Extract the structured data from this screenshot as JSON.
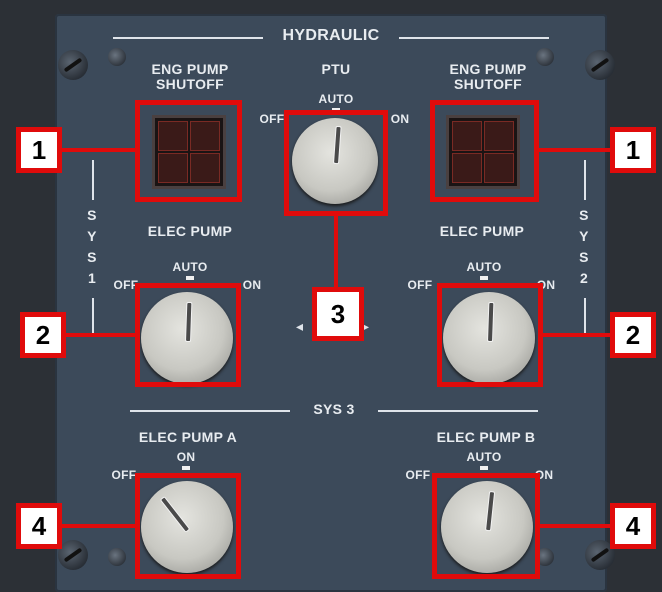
{
  "panel": {
    "title": "HYDRAULIC",
    "sys3_label": "SYS 3",
    "sys1_side_label": [
      "S",
      "Y",
      "S",
      "1"
    ],
    "sys2_side_label": [
      "S",
      "Y",
      "S",
      "2"
    ]
  },
  "eng_pump_left": {
    "label_line1": "ENG PUMP",
    "label_line2": "SHUTOFF"
  },
  "eng_pump_right": {
    "label_line1": "ENG PUMP",
    "label_line2": "SHUTOFF"
  },
  "ptu": {
    "label": "PTU",
    "pos_off": "OFF",
    "pos_auto": "AUTO",
    "pos_on": "ON"
  },
  "elec_pump_left": {
    "label": "ELEC PUMP",
    "pos_off": "OFF",
    "pos_auto": "AUTO",
    "pos_on": "ON"
  },
  "elec_pump_right": {
    "label": "ELEC PUMP",
    "pos_off": "OFF",
    "pos_auto": "AUTO",
    "pos_on": "ON"
  },
  "elec_pump_a": {
    "label": "ELEC PUMP A",
    "pos_off": "OFF",
    "pos_on": "ON"
  },
  "elec_pump_b": {
    "label": "ELEC PUMP B",
    "pos_off": "OFF",
    "pos_auto": "AUTO",
    "pos_on": "ON"
  },
  "callouts": {
    "eng_pump_left": "1",
    "eng_pump_right": "1",
    "elec_pump_left": "2",
    "elec_pump_right": "2",
    "ptu": "3",
    "elec_pump_a": "4",
    "elec_pump_b": "4"
  },
  "colors": {
    "callout_red": "#e00b0b",
    "panel": "#3c4a5a",
    "legend_text": "#e8ecf0"
  }
}
